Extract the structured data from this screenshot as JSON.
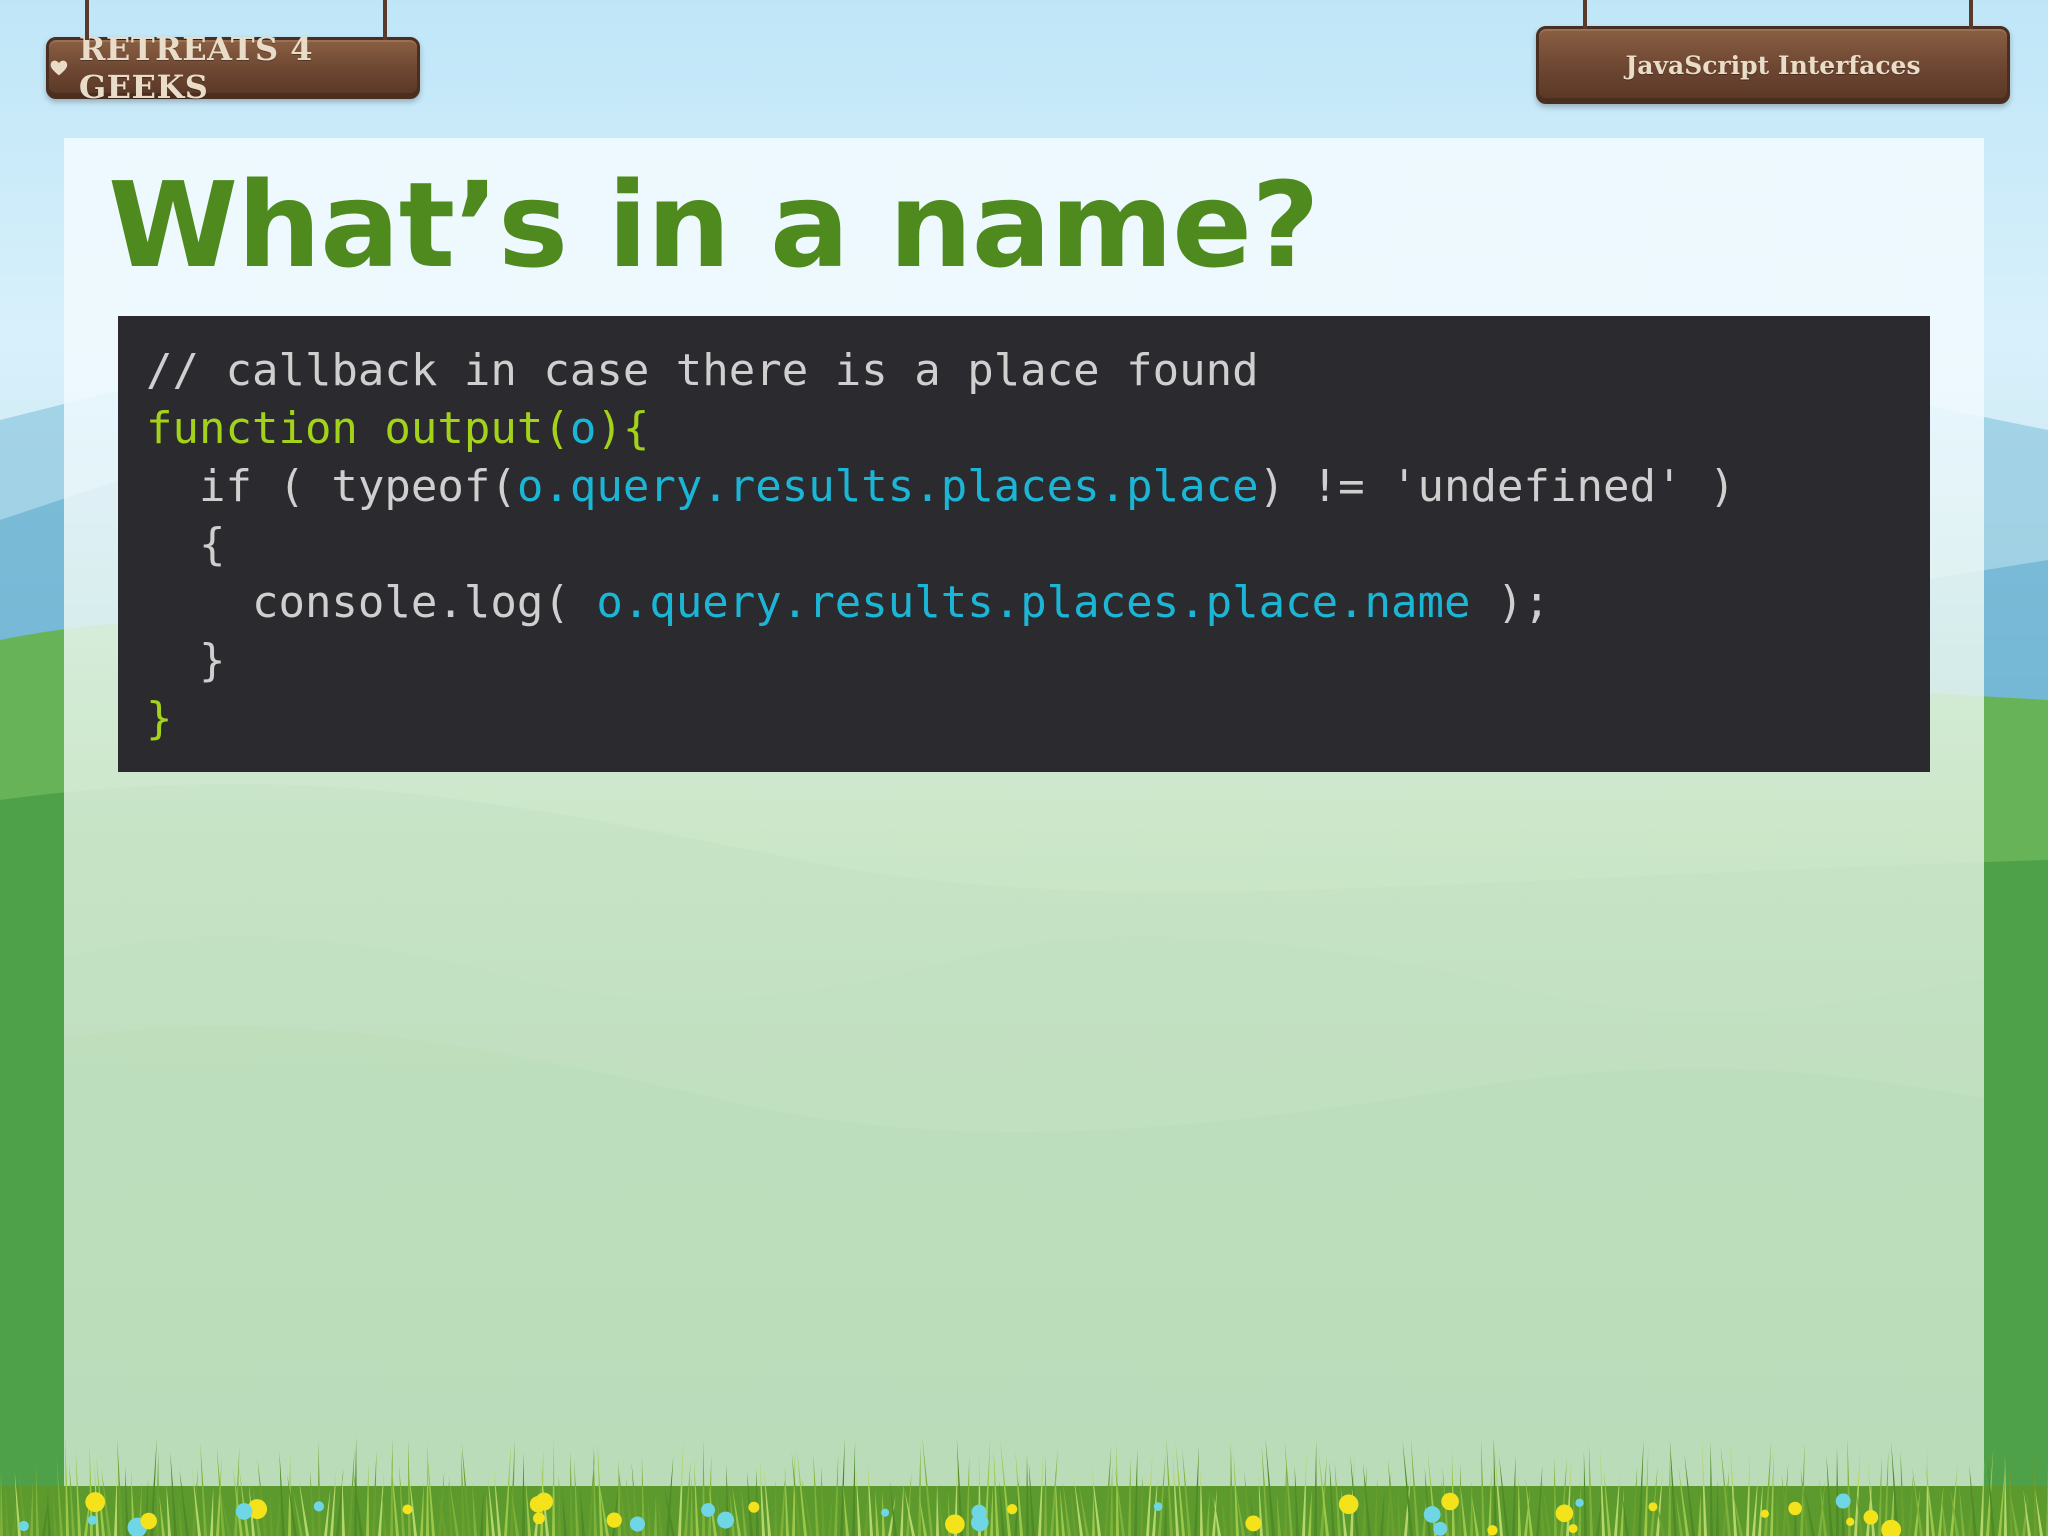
{
  "logo": {
    "text": "RETREATS 4 GEEKS"
  },
  "topic_sign": {
    "text": "JavaScript Interfaces"
  },
  "slide": {
    "title": "What’s in a name?"
  },
  "code": {
    "lines": [
      [
        {
          "t": "plain",
          "s": "// callback in case there is a place found"
        }
      ],
      [
        {
          "t": "keyword",
          "s": "function output("
        },
        {
          "t": "ident",
          "s": "o"
        },
        {
          "t": "keyword",
          "s": "){"
        }
      ],
      [
        {
          "t": "plain",
          "s": "  if ( typeof("
        },
        {
          "t": "ident",
          "s": "o.query.results.places.place"
        },
        {
          "t": "plain",
          "s": ") != 'undefined' )"
        }
      ],
      [
        {
          "t": "plain",
          "s": "  {"
        }
      ],
      [
        {
          "t": "plain",
          "s": "    console.log( "
        },
        {
          "t": "ident",
          "s": "o.query.results.places.place.name"
        },
        {
          "t": "plain",
          "s": " );"
        }
      ],
      [
        {
          "t": "plain",
          "s": "  }"
        }
      ],
      [
        {
          "t": "keyword",
          "s": "}"
        }
      ]
    ]
  },
  "colors": {
    "title": "#4e8a1e",
    "code_bg": "#2b2a2e",
    "code_plain": "#cfcfcf",
    "code_keyword": "#a3d21a",
    "code_ident": "#1bb6d6",
    "sign_wood": "#6a4430"
  }
}
